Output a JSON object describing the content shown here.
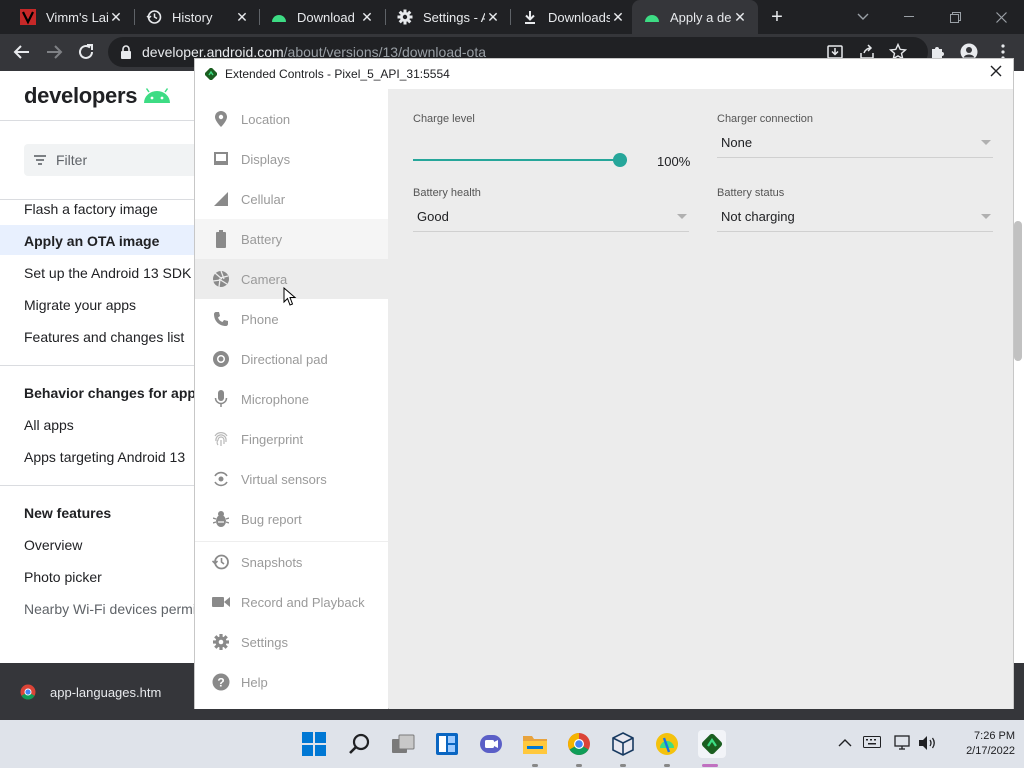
{
  "browser": {
    "tabs": [
      {
        "title": "Vimm's Lai",
        "favicon": "vimm-icon",
        "active": false
      },
      {
        "title": "History",
        "favicon": "history-icon",
        "active": false
      },
      {
        "title": "Download",
        "favicon": "android-icon",
        "active": false
      },
      {
        "title": "Settings - A",
        "favicon": "gear-icon",
        "active": false
      },
      {
        "title": "Downloads",
        "favicon": "download-icon",
        "active": false
      },
      {
        "title": "Apply a de",
        "favicon": "android-icon",
        "active": true
      }
    ],
    "url_host": "developer.android.com",
    "url_path": "/about/versions/13/download-ota"
  },
  "page": {
    "logo_text": "developers",
    "filter_placeholder": "Filter",
    "nav": [
      {
        "label": "Flash a factory image"
      },
      {
        "label": "Apply an OTA image",
        "active": true
      },
      {
        "label": "Set up the Android 13 SDK"
      },
      {
        "label": "Migrate your apps"
      },
      {
        "label": "Features and changes list"
      }
    ],
    "section_behavior": "Behavior changes for apps",
    "behavior_items": [
      {
        "label": "All apps"
      },
      {
        "label": "Apps targeting Android 13"
      }
    ],
    "section_features": "New features",
    "feature_items": [
      {
        "label": "Overview"
      },
      {
        "label": "Photo picker"
      },
      {
        "label": "Nearby Wi-Fi devices permi"
      }
    ]
  },
  "download_shelf": {
    "file": "app-languages.htm"
  },
  "extended_controls": {
    "title": "Extended Controls - Pixel_5_API_31:5554",
    "sidebar": [
      {
        "label": "Location",
        "icon": "location-pin-icon"
      },
      {
        "label": "Displays",
        "icon": "display-icon"
      },
      {
        "label": "Cellular",
        "icon": "cellular-signal-icon"
      },
      {
        "label": "Battery",
        "icon": "battery-icon",
        "selected": true
      },
      {
        "label": "Camera",
        "icon": "camera-aperture-icon",
        "hover": true
      },
      {
        "label": "Phone",
        "icon": "phone-icon"
      },
      {
        "label": "Directional pad",
        "icon": "dpad-icon"
      },
      {
        "label": "Microphone",
        "icon": "microphone-icon"
      },
      {
        "label": "Fingerprint",
        "icon": "fingerprint-icon"
      },
      {
        "label": "Virtual sensors",
        "icon": "virtual-sensors-icon"
      },
      {
        "label": "Bug report",
        "icon": "bug-icon"
      },
      {
        "label": "Snapshots",
        "icon": "snapshot-history-icon"
      },
      {
        "label": "Record and Playback",
        "icon": "video-camera-icon"
      },
      {
        "label": "Settings",
        "icon": "gear-icon"
      },
      {
        "label": "Help",
        "icon": "help-icon"
      }
    ],
    "battery": {
      "charge_level_label": "Charge level",
      "charge_level_value": "100%",
      "charge_level_fraction": 1.0,
      "charger_connection_label": "Charger connection",
      "charger_connection_value": "None",
      "battery_health_label": "Battery health",
      "battery_health_value": "Good",
      "battery_status_label": "Battery status",
      "battery_status_value": "Not charging"
    },
    "accent_color": "#26a69a"
  },
  "taskbar": {
    "time": "7:26 PM",
    "date": "2/17/2022"
  }
}
